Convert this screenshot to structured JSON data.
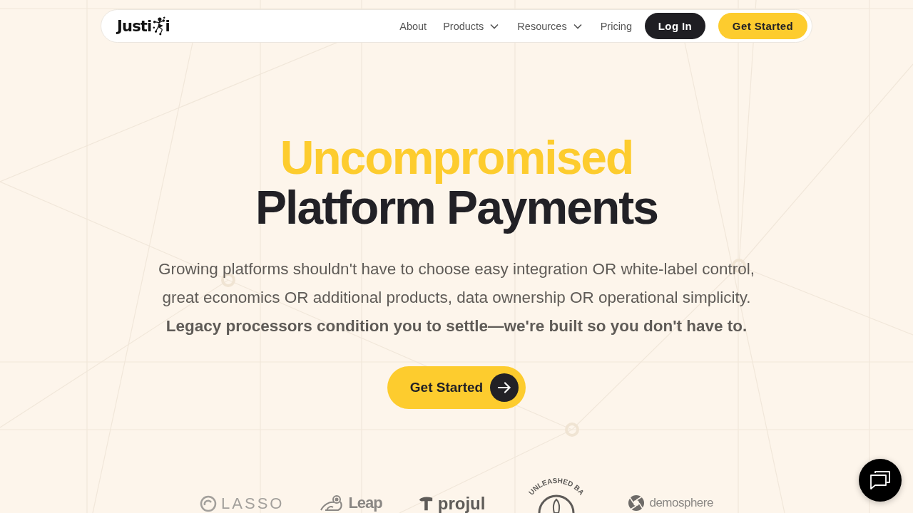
{
  "nav": {
    "logo": {
      "text_start": "Justi",
      "text_end": "i"
    },
    "links": [
      {
        "label": "About",
        "kind": "link"
      },
      {
        "label": "Products",
        "kind": "dropdown"
      },
      {
        "label": "Resources",
        "kind": "dropdown"
      },
      {
        "label": "Pricing",
        "kind": "link"
      }
    ],
    "buttons": [
      {
        "label": "Log In",
        "kind": "dark"
      },
      {
        "label": "Get Started",
        "kind": "accent"
      }
    ]
  },
  "hero": {
    "headline_accent": "Uncompromised",
    "headline": "Platform Payments",
    "subtitle": "Growing platforms shouldn't have to choose easy integration OR white-label control, great economics OR additional products, data ownership OR operational simplicity.",
    "emphasis": "Legacy processors condition you to settle—we're built so you don't have to.",
    "cta": "Get Started"
  },
  "client_logos": [
    {
      "kind": "ring",
      "text": "LASSO"
    },
    {
      "kind": "frog",
      "text": "Leap"
    },
    {
      "kind": "hammer",
      "text": "projul"
    },
    {
      "kind": "badge",
      "text": "UNLEASHED BA"
    },
    {
      "kind": "aperture",
      "text": "demosphere"
    }
  ]
}
